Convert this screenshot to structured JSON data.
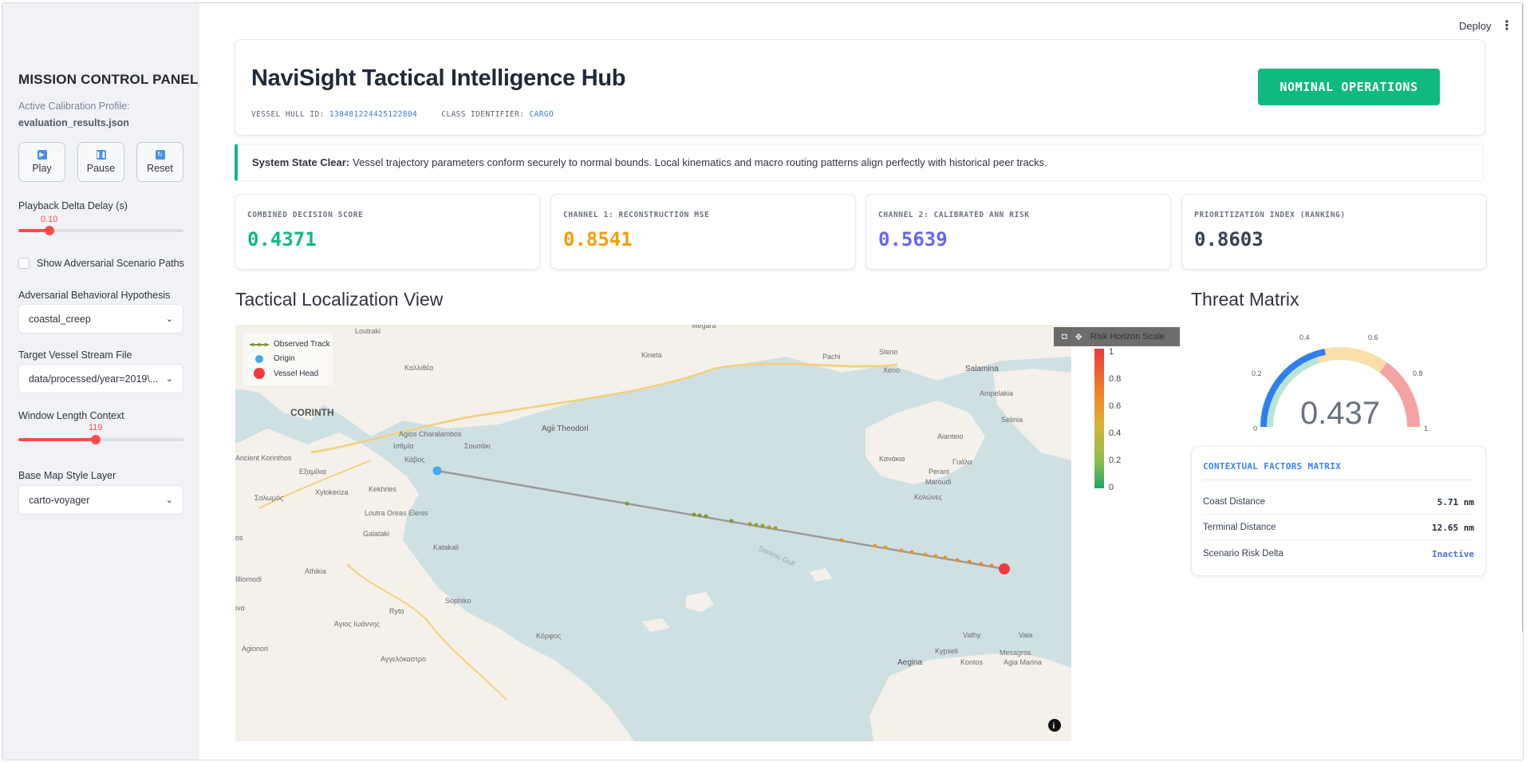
{
  "sidebar": {
    "title": "MISSION CONTROL PANEL",
    "calibration_label": "Active Calibration Profile:",
    "calibration_value": "evaluation_results.json",
    "buttons": {
      "play": "Play",
      "pause": "Pause",
      "reset": "Reset"
    },
    "playback_delay": {
      "label": "Playback Delta Delay (s)",
      "value": "0.10",
      "fraction": 0.18
    },
    "adversarial_paths": {
      "label": "Show Adversarial Scenario Paths",
      "checked": false
    },
    "hypothesis": {
      "label": "Adversarial Behavioral Hypothesis",
      "value": "coastal_creep"
    },
    "stream_file": {
      "label": "Target Vessel Stream File",
      "value": "data/processed/year=2019\\..."
    },
    "window_length": {
      "label": "Window Length Context",
      "value": "119",
      "fraction": 0.46
    },
    "base_map": {
      "label": "Base Map Style Layer",
      "value": "carto-voyager"
    }
  },
  "topbar": {
    "deploy": "Deploy",
    "menu": "⋮"
  },
  "header": {
    "title": "NaviSight Tactical Intelligence Hub",
    "hull_label": "VESSEL HULL ID:",
    "hull_value": "130481224425122804",
    "class_label": "CLASS IDENTIFIER:",
    "class_value": "CARGO",
    "status": "NOMINAL OPERATIONS"
  },
  "alert": {
    "strong": "System State Clear:",
    "text": "Vessel trajectory parameters conform securely to normal bounds. Local kinematics and macro routing patterns align perfectly with historical peer tracks."
  },
  "metrics": [
    {
      "label": "COMBINED DECISION SCORE",
      "value": "0.4371",
      "color": "#10b981"
    },
    {
      "label": "CHANNEL 1: RECONSTRUCTION MSE",
      "value": "0.8541",
      "color": "#f59e0b"
    },
    {
      "label": "CHANNEL 2: CALIBRATED ANN RISK",
      "value": "0.5639",
      "color": "#6366f1"
    },
    {
      "label": "PRIORITIZATION INDEX (RANKING)",
      "value": "0.8603",
      "color": "#374151"
    }
  ],
  "map": {
    "title": "Tactical Localization View",
    "legend": {
      "track": "Observed Track",
      "origin": "Origin",
      "head": "Vessel Head"
    },
    "colorbar_title": "Risk Horizon Scale",
    "colorbar_ticks": [
      "1",
      "0.8",
      "0.6",
      "0.4",
      "0.2",
      "0"
    ],
    "places": [
      "Megara",
      "Loutraki",
      "Καλλιθέα",
      "Kineta",
      "Pachi",
      "Steno",
      "Xeno",
      "Salamina",
      "Ampelakia",
      "Selinia",
      "CORINTH",
      "Agios Charalambos",
      "Ισθμία",
      "Σουσάκι",
      "Agii Theodori",
      "Aianteio",
      "Κανάκια",
      "Perani",
      "Maroudi",
      "Γυάλα",
      "Κολώνες",
      "Ancient Korinthos",
      "Κάβος",
      "Εξαμίλια",
      "Xylokeriza",
      "Kekhries",
      "Σολωμός",
      "Loutra Oreas Elenis",
      "Galataki",
      "Katakali",
      "Athikia",
      "Sophiko",
      "Άγιος Ιωάννης",
      "Ryto",
      "Κόρφος",
      "Agionori",
      "Αγγελόκαστρο",
      "Vathy",
      "Kypseli",
      "Vaia",
      "Mesagros",
      "Aegina",
      "Kontos",
      "Agia Marina",
      "Saronic Gulf"
    ]
  },
  "threat": {
    "title": "Threat Matrix",
    "gauge_value": 0.437,
    "gauge_display": "0.437",
    "gauge_ticks": [
      "0",
      "0.2",
      "0.4",
      "0.6",
      "0.8",
      "1"
    ],
    "context_title": "CONTEXTUAL FACTORS MATRIX",
    "rows": [
      {
        "label": "Coast Distance",
        "value": "5.71 nm"
      },
      {
        "label": "Terminal Distance",
        "value": "12.65 nm"
      },
      {
        "label": "Scenario Risk Delta",
        "value": "Inactive"
      }
    ]
  },
  "colors": {
    "accent": "#ff4b4b",
    "ok": "#10b981",
    "link": "#3a7bd5",
    "sea": "#cfe0e3",
    "land": "#f4f1ea"
  }
}
